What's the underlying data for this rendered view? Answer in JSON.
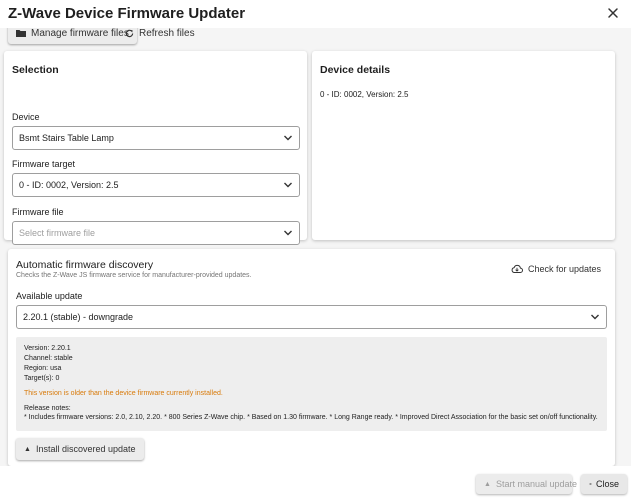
{
  "dialog": {
    "title": "Z-Wave Device Firmware Updater",
    "close_icon": "close-icon"
  },
  "toolbar": {
    "manage_label": "Manage firmware files",
    "manage_icon": "folder-icon",
    "refresh_label": "Refresh files",
    "refresh_icon": "refresh-icon"
  },
  "selection": {
    "title": "Selection",
    "device_label": "Device",
    "device_value": "Bsmt Stairs Table Lamp",
    "target_label": "Firmware target",
    "target_value": "0 - ID: 0002, Version: 2.5",
    "file_label": "Firmware file",
    "file_placeholder": "Select firmware file"
  },
  "device_details": {
    "title": "Device details",
    "text": "0 - ID: 0002, Version: 2.5"
  },
  "discovery": {
    "title": "Automatic firmware discovery",
    "subtitle": "Checks the Z-Wave JS firmware service for manufacturer-provided updates.",
    "check_label": "Check for updates",
    "check_icon": "cloud-download-icon",
    "available_label": "Available update",
    "available_value": "2.20.1 (stable) - downgrade",
    "info": {
      "version": "Version: 2.20.1",
      "channel": "Channel: stable",
      "region": "Region: usa",
      "targets": "Target(s): 0",
      "warning": "This version is older than the device firmware currently installed.",
      "notes_label": "Release notes:",
      "notes_text": "* Includes firmware versions: 2.0, 2.10, 2.20. * 800 Series Z-Wave chip. * Based on 1.30 firmware. * Long Range ready. * Improved Direct Association for the basic set on/off functionality."
    },
    "install_label": "Install discovered update",
    "install_icon": "caret-up-icon"
  },
  "footer": {
    "start_label": "Start manual update",
    "close_label": "Close"
  },
  "colors": {
    "warning": "#d87a0a",
    "panel_bg": "#f5f5f5",
    "info_bg": "#eeeeee"
  }
}
